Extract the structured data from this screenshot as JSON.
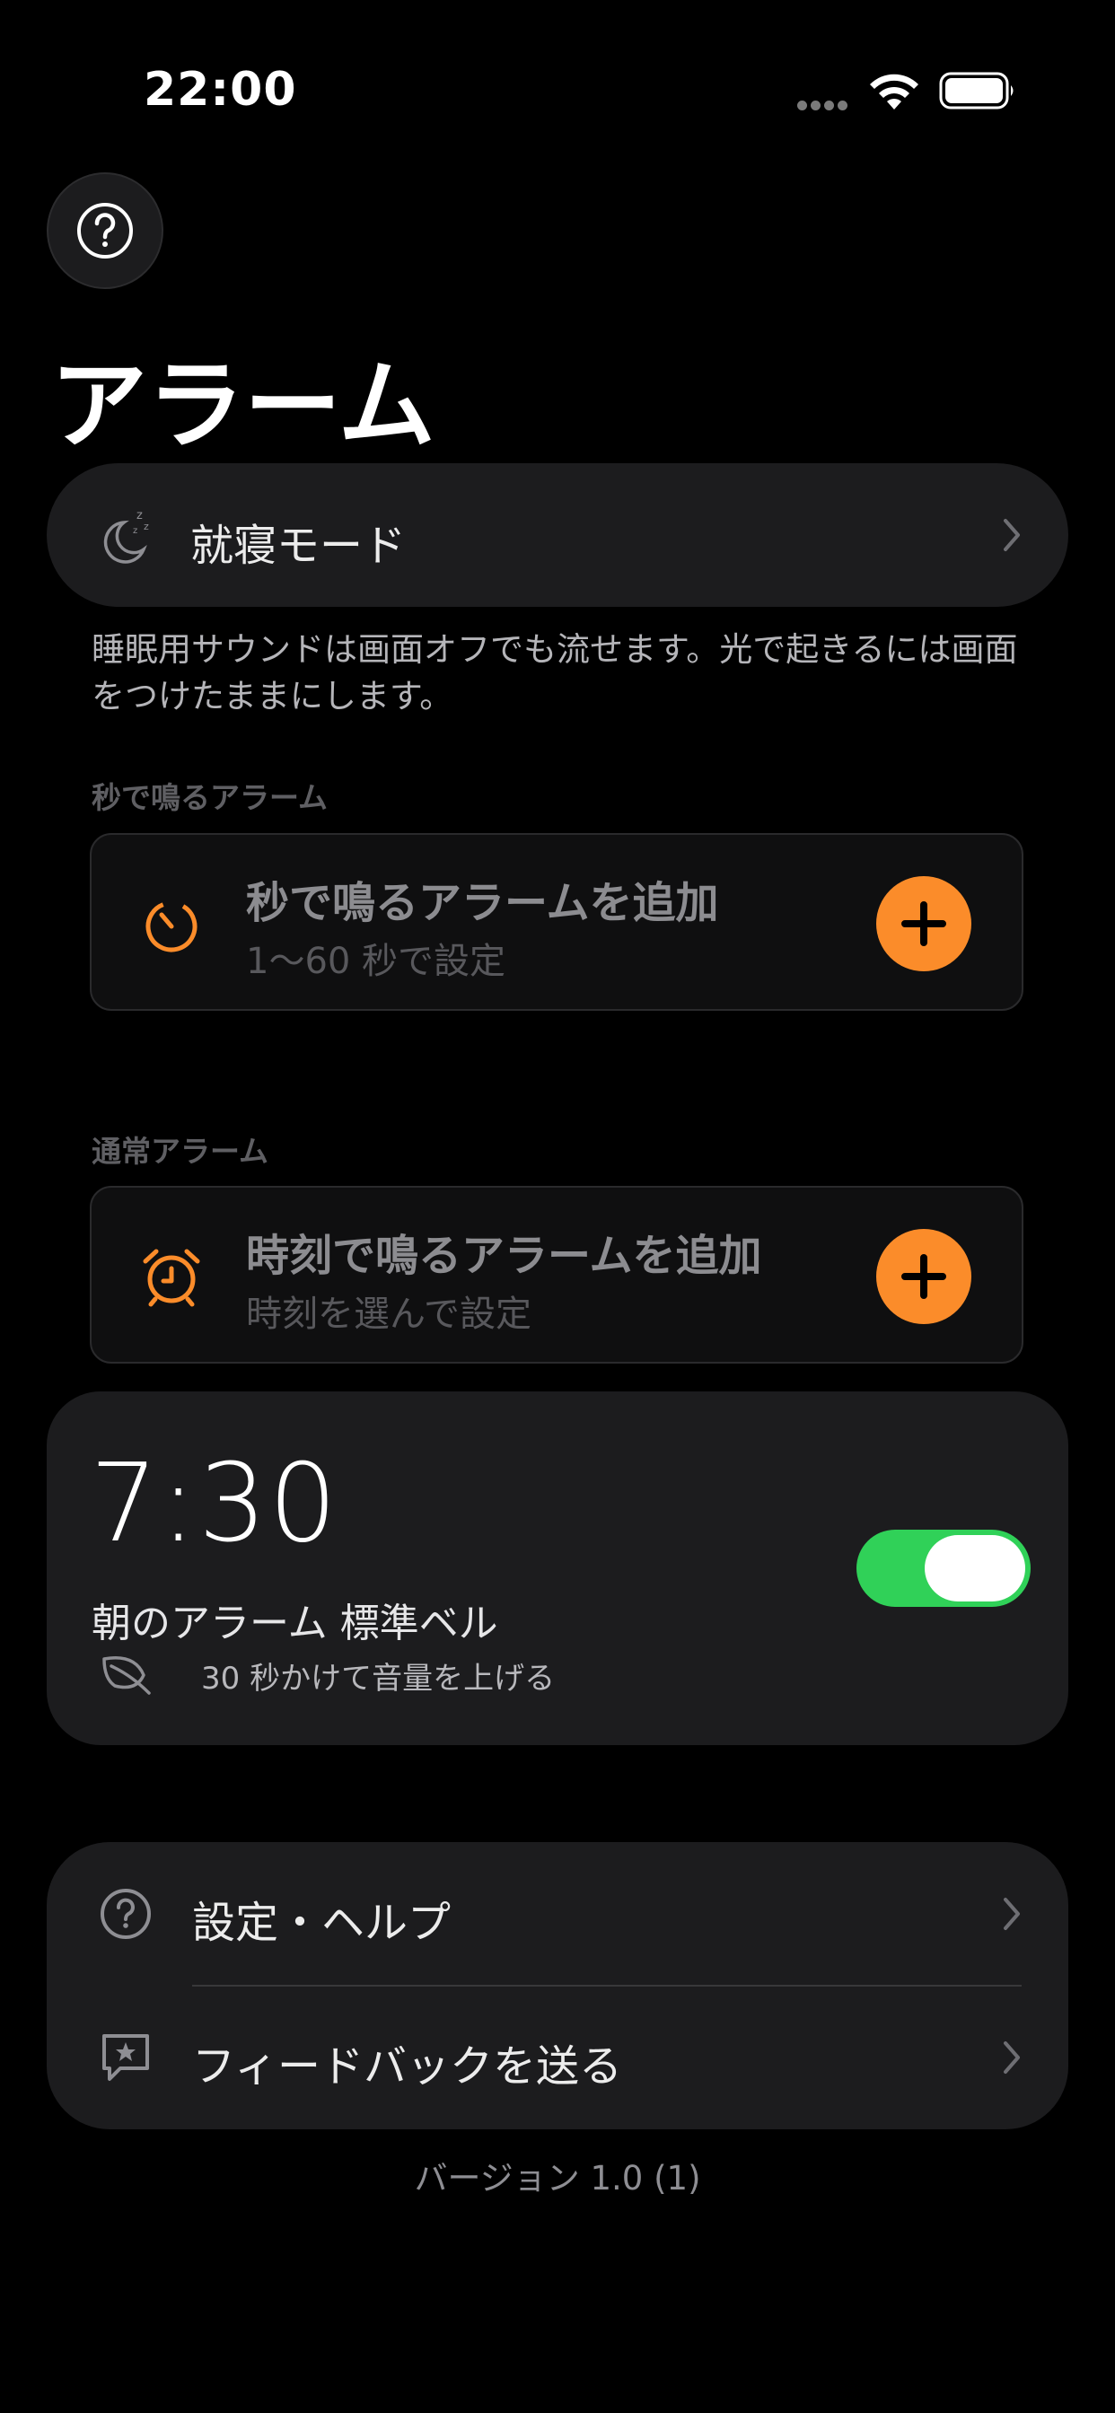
{
  "status_bar": {
    "time": "22:00",
    "signal": "signal-dots-icon",
    "wifi": "wifi-icon",
    "battery": "battery-icon"
  },
  "header": {
    "help_icon": "question-circle-icon",
    "title": "アラーム"
  },
  "sleep_mode": {
    "icon": "moon-zzz-icon",
    "label": "就寝モード"
  },
  "note": "睡眠用サウンドは画面オフでも流せます。光で起きるには画面をつけたままにします。",
  "seconds_section": {
    "label": "秒で鳴るアラーム",
    "card_title": "秒で鳴るアラームを追加",
    "card_sub": "1〜60 秒で設定",
    "icon": "timer-icon"
  },
  "normal_section": {
    "label": "通常アラーム",
    "card_title": "時刻で鳴るアラームを追加",
    "card_sub": "時刻を選んで設定",
    "icon": "alarm-clock-icon"
  },
  "alarm": {
    "time": "7:30",
    "name": "朝のアラーム  標準ベル",
    "fade_text": "30 秒かけて音量を上げる",
    "enabled": true
  },
  "menu": {
    "items": [
      {
        "label": "設定・ヘルプ",
        "icon": "question-circle-icon"
      },
      {
        "label": "フィードバックを送る",
        "icon": "feedback-star-icon"
      }
    ]
  },
  "version": "バージョン 1.0 (1)",
  "colors": {
    "accent": "#fb8c2a",
    "toggle_on": "#30d158",
    "card_bg": "#1c1c1e"
  }
}
